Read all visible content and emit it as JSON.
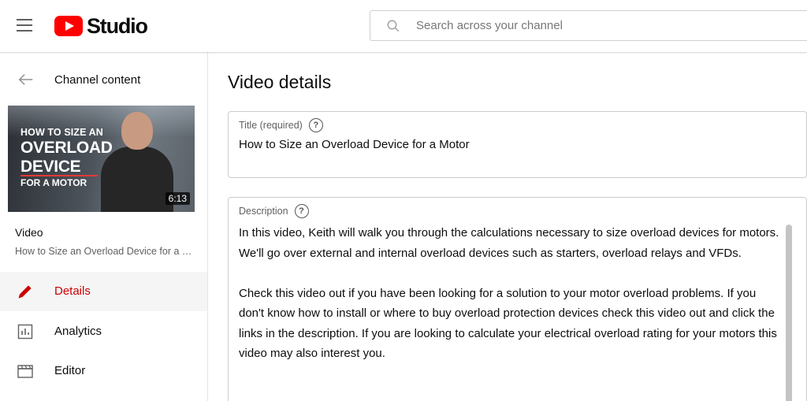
{
  "header": {
    "logo_text": "Studio",
    "search_placeholder": "Search across your channel",
    "brand_color": "#ff0000"
  },
  "sidebar": {
    "back_label": "Channel content",
    "thumbnail": {
      "line1": "HOW TO SIZE AN",
      "line2": "OVERLOAD",
      "line3": "DEVICE",
      "line4": "FOR A MOTOR",
      "duration": "6:13"
    },
    "video_label": "Video",
    "video_title": "How to Size an Overload Device for a Motor",
    "nav": [
      {
        "label": "Details",
        "icon": "pencil-icon",
        "active": true
      },
      {
        "label": "Analytics",
        "icon": "analytics-icon",
        "active": false
      },
      {
        "label": "Editor",
        "icon": "clapperboard-icon",
        "active": false
      }
    ],
    "active_color": "#cc0000"
  },
  "main": {
    "page_title": "Video details",
    "title_field": {
      "label": "Title (required)",
      "value": "How to Size an Overload Device for a Motor"
    },
    "description_field": {
      "label": "Description",
      "paragraphs": [
        "In this video, Keith will walk you through the calculations necessary to size overload devices for motors. We'll go over external and internal overload devices such as starters, overload relays and VFDs.",
        "Check this video out if you have been looking for a solution to your motor overload problems. If you don't know how to install or where to buy overload protection devices check this video out and click the links in the description. If you are looking to calculate your electrical overload rating for your motors this video may also interest you."
      ]
    }
  }
}
